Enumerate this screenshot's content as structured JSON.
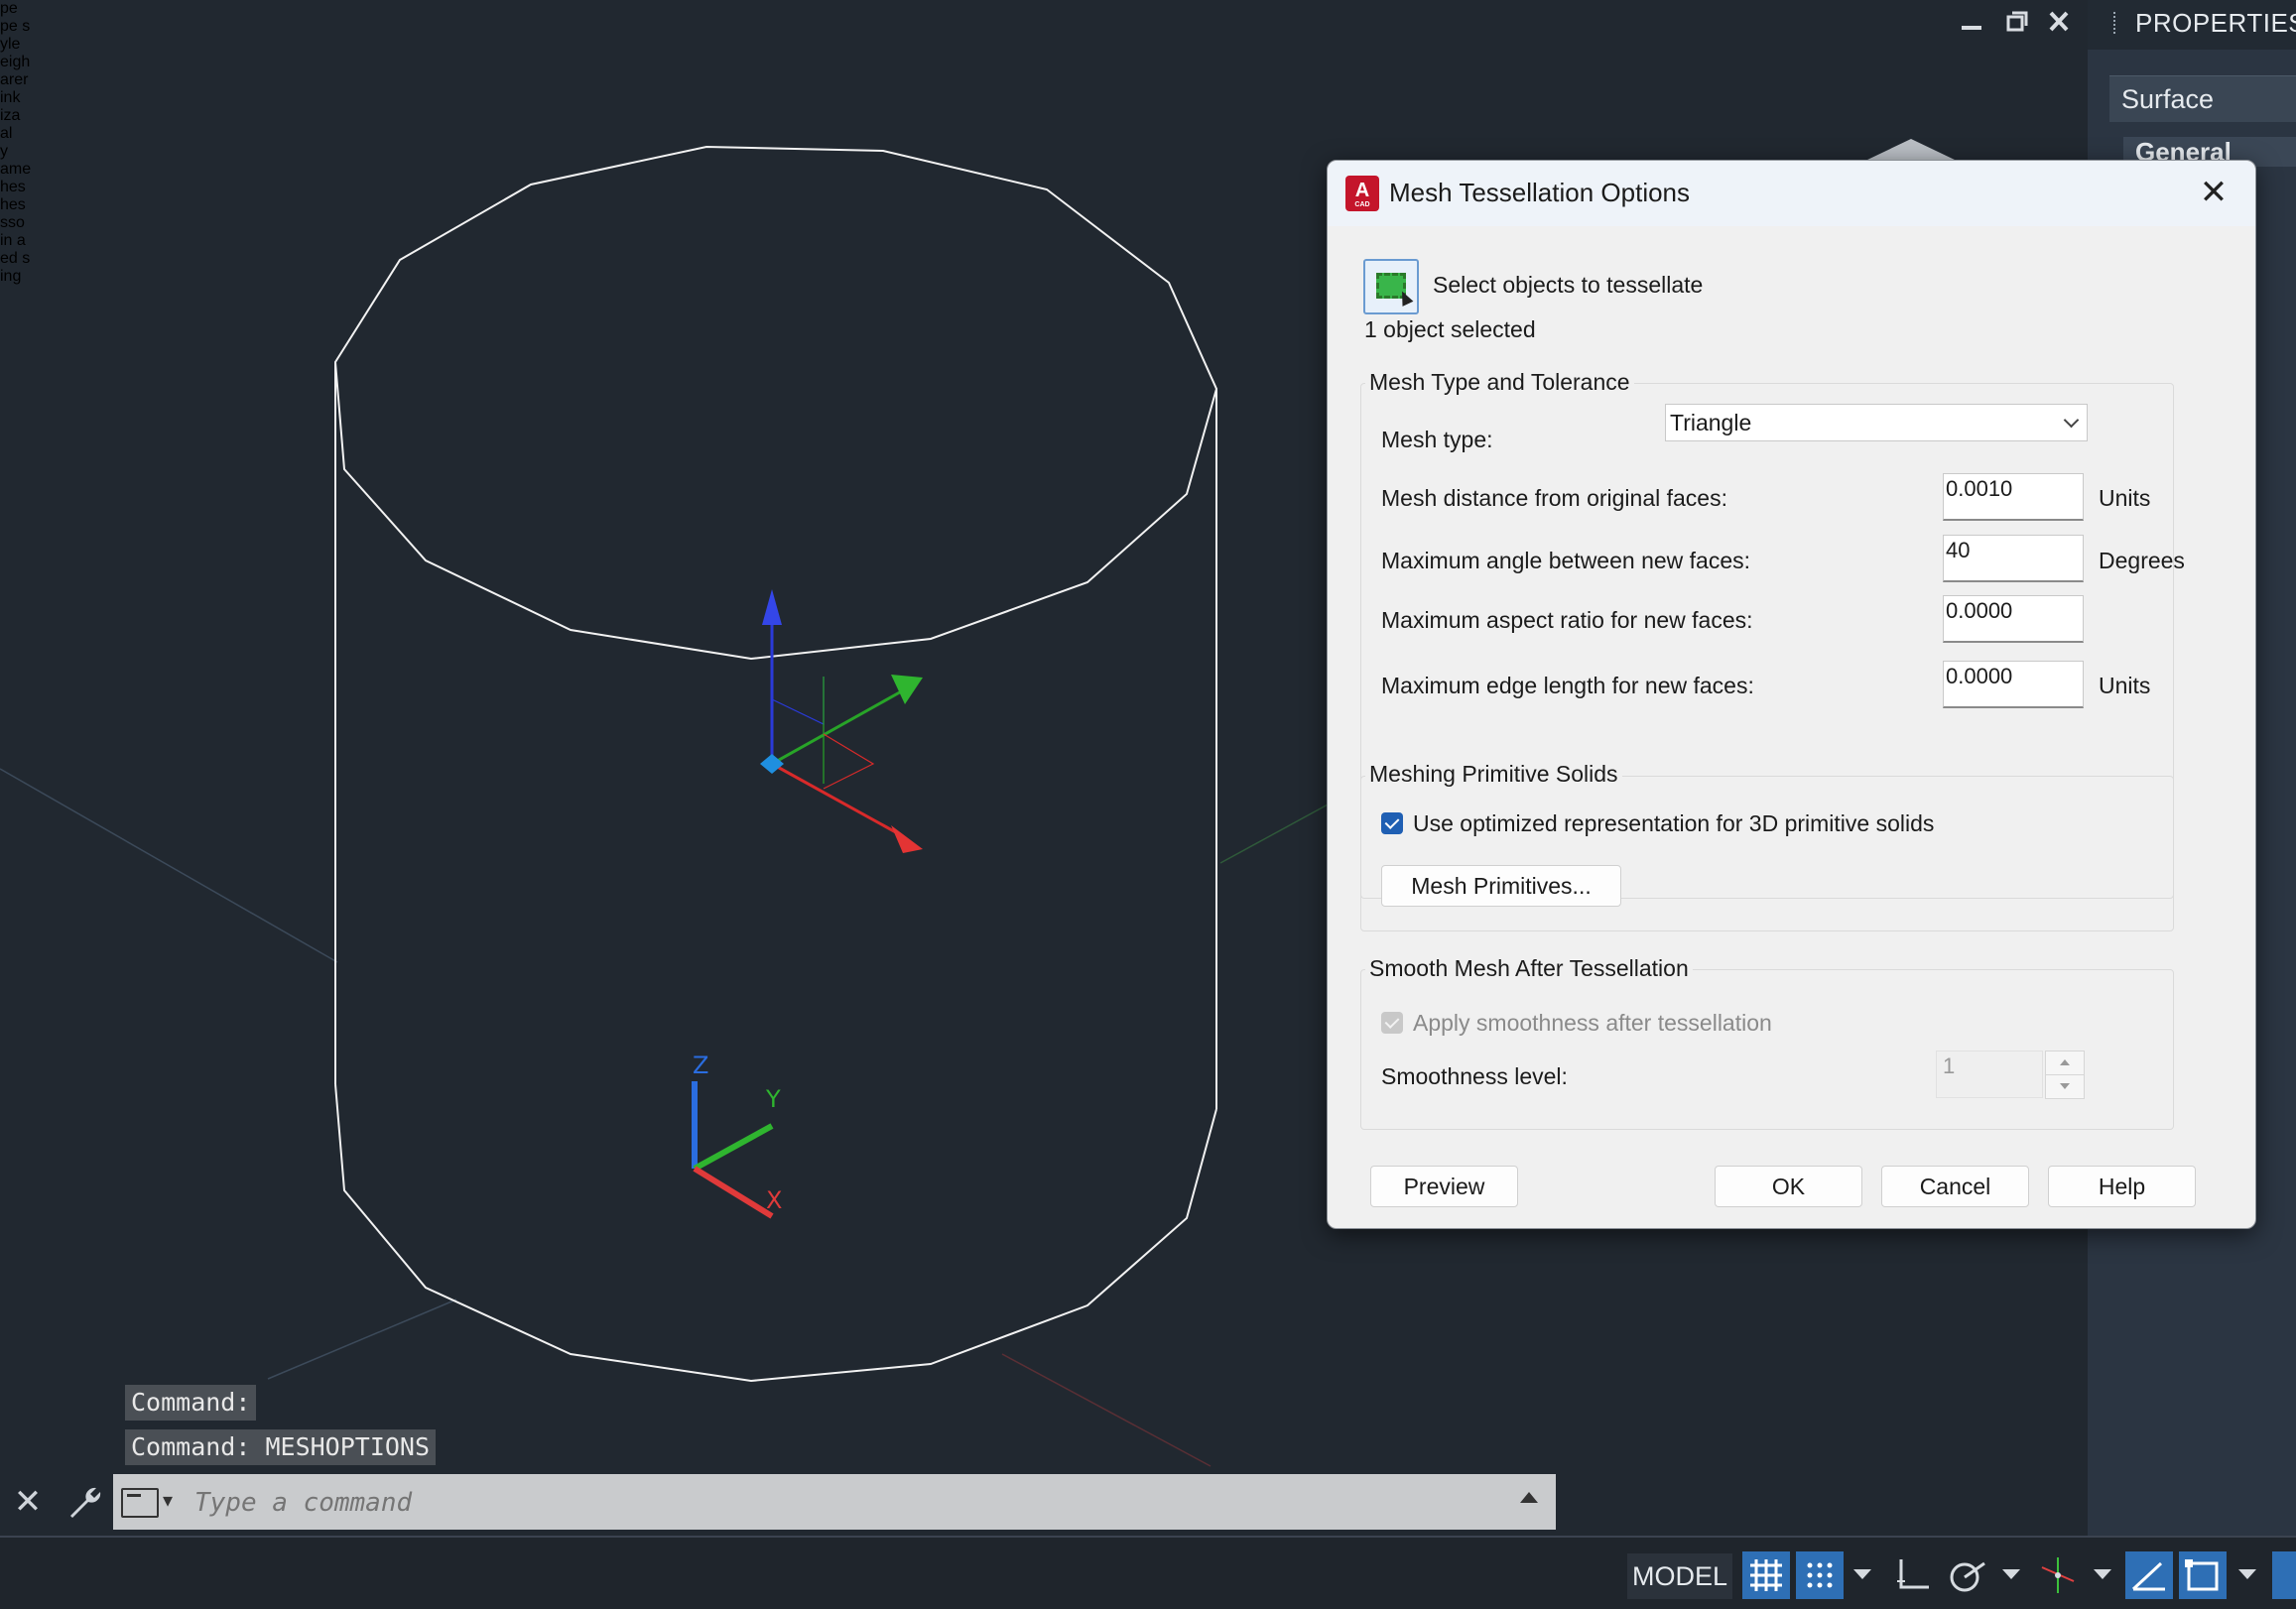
{
  "window_controls": {
    "minimize": "minimize-icon",
    "restore": "restore-icon",
    "close": "close-icon"
  },
  "properties": {
    "title": "PROPERTIES",
    "selected_type": "Surface",
    "section_general": "General",
    "cutoff_fragments": [
      "pe",
      "pe s",
      "yle",
      "eigh",
      "arer",
      "ink",
      "iza",
      "al",
      "y",
      "ame",
      "hes",
      "hes",
      "sso",
      "in a",
      "ed s",
      "ing"
    ]
  },
  "command_history": [
    "Command:",
    "Command: MESHOPTIONS"
  ],
  "command_input": {
    "placeholder": "Type a command"
  },
  "status": {
    "model_label": "MODEL"
  },
  "ucs": {
    "z_label": "Z",
    "y_label": "Y",
    "x_label": "X"
  },
  "dialog": {
    "title": "Mesh Tessellation Options",
    "app_icon_letter": "A",
    "app_icon_sub": "CAD",
    "select_label": "Select objects to tessellate",
    "selected_count": "1 object selected",
    "group1": {
      "title": "Mesh Type and Tolerance",
      "mesh_type_label": "Mesh type:",
      "mesh_type_value": "Triangle",
      "distance_label": "Mesh distance from original faces:",
      "distance_value": "0.0010",
      "distance_unit": "Units",
      "angle_label": "Maximum angle between new faces:",
      "angle_value": "40",
      "angle_unit": "Degrees",
      "aspect_label": "Maximum aspect ratio for new faces:",
      "aspect_value": "0.0000",
      "edge_label": "Maximum edge length for new faces:",
      "edge_value": "0.0000",
      "edge_unit": "Units"
    },
    "group2": {
      "title": "Meshing Primitive Solids",
      "optimized_label": "Use optimized representation for 3D primitive solids",
      "optimized_checked": true,
      "primitives_button": "Mesh Primitives..."
    },
    "group3": {
      "title": "Smooth Mesh After Tessellation",
      "apply_label": "Apply smoothness after tessellation",
      "apply_checked": true,
      "level_label": "Smoothness level:",
      "level_value": "1"
    },
    "buttons": {
      "preview": "Preview",
      "ok": "OK",
      "cancel": "Cancel",
      "help": "Help"
    }
  }
}
